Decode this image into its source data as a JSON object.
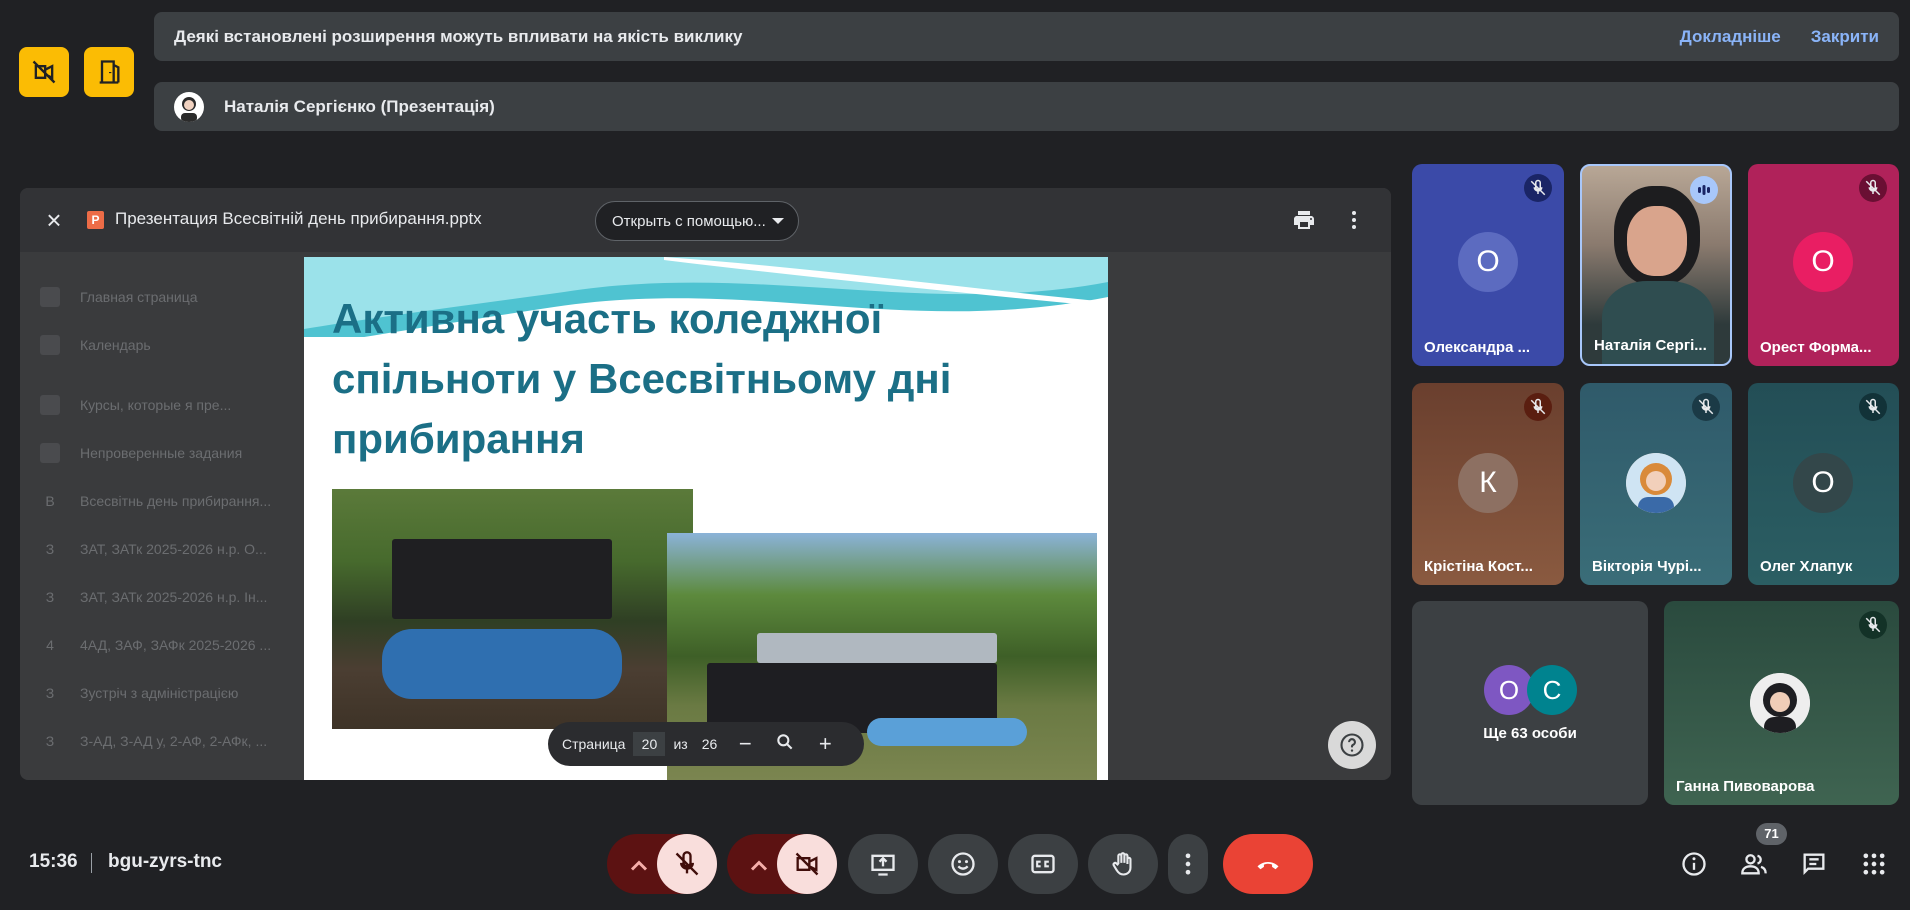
{
  "notifications": {
    "extensions_message": "Деякі встановлені розширення можуть впливати на якість виклику",
    "details_label": "Докладніше",
    "close_label": "Закрити",
    "presenter_label": "Наталія Сергієнко (Презентація)"
  },
  "viewer": {
    "file_name": "Презентация Всесвітній день прибирання.pptx",
    "file_type_letter": "P",
    "open_with_label": "Открыть с помощью...",
    "background_list": [
      {
        "label": "Главная страница"
      },
      {
        "label": "Календарь"
      },
      {
        "label": "Курсы, которые я пре..."
      },
      {
        "label": "Непроверенные задания"
      },
      {
        "num": "В",
        "label": "Всесвітнь день прибирання..."
      },
      {
        "num": "З",
        "label": "ЗАТ, ЗАТк 2025-2026 н.р. О..."
      },
      {
        "num": "З",
        "label": "ЗАТ, ЗАТк 2025-2026 н.р. Ін..."
      },
      {
        "num": "4",
        "label": "4АД, ЗАФ, ЗАФк 2025-2026 ..."
      },
      {
        "num": "З",
        "label": "Зустріч з адміністрацією"
      },
      {
        "num": "З",
        "label": "З-АД, З-АД у, 2-АФ, 2-АФк, ..."
      }
    ],
    "slide": {
      "title_line1": "Активна участь коледжної",
      "title_line2": "спільноти у Всесвітньому дні",
      "title_line3": "прибирання"
    },
    "pager": {
      "page_label": "Страница",
      "current": "20",
      "of_label": "из",
      "total": "26"
    }
  },
  "participants": [
    {
      "name": "Олександра ...",
      "initial": "О",
      "muted": true
    },
    {
      "name": "Наталія Сергі...",
      "speaking": true
    },
    {
      "name": "Орест Форма...",
      "initial": "О",
      "muted": true
    },
    {
      "name": "Крістіна Кост...",
      "initial": "К",
      "muted": true
    },
    {
      "name": "Вікторія Чурі...",
      "muted": true
    },
    {
      "name": "Олег Хлапук",
      "initial": "О",
      "muted": true
    },
    {
      "more_label": "Ще 63 особи",
      "initials": [
        "О",
        "С"
      ]
    },
    {
      "name": "Ганна Пивоварова",
      "muted": true
    }
  ],
  "meeting": {
    "time": "15:36",
    "code": "bgu-zyrs-tnc",
    "participant_count": "71"
  },
  "colors": {
    "background": "#202124",
    "accent_link": "#8ab4f8",
    "badge_yellow": "#fbbc04",
    "end_call_red": "#ea4335",
    "slide_title": "#1b6f86"
  },
  "icons": {
    "badge1": "no-video-icon",
    "badge2": "door-icon",
    "close": "close-icon",
    "print": "print-icon",
    "more": "more-vert-icon",
    "help": "help-icon"
  }
}
